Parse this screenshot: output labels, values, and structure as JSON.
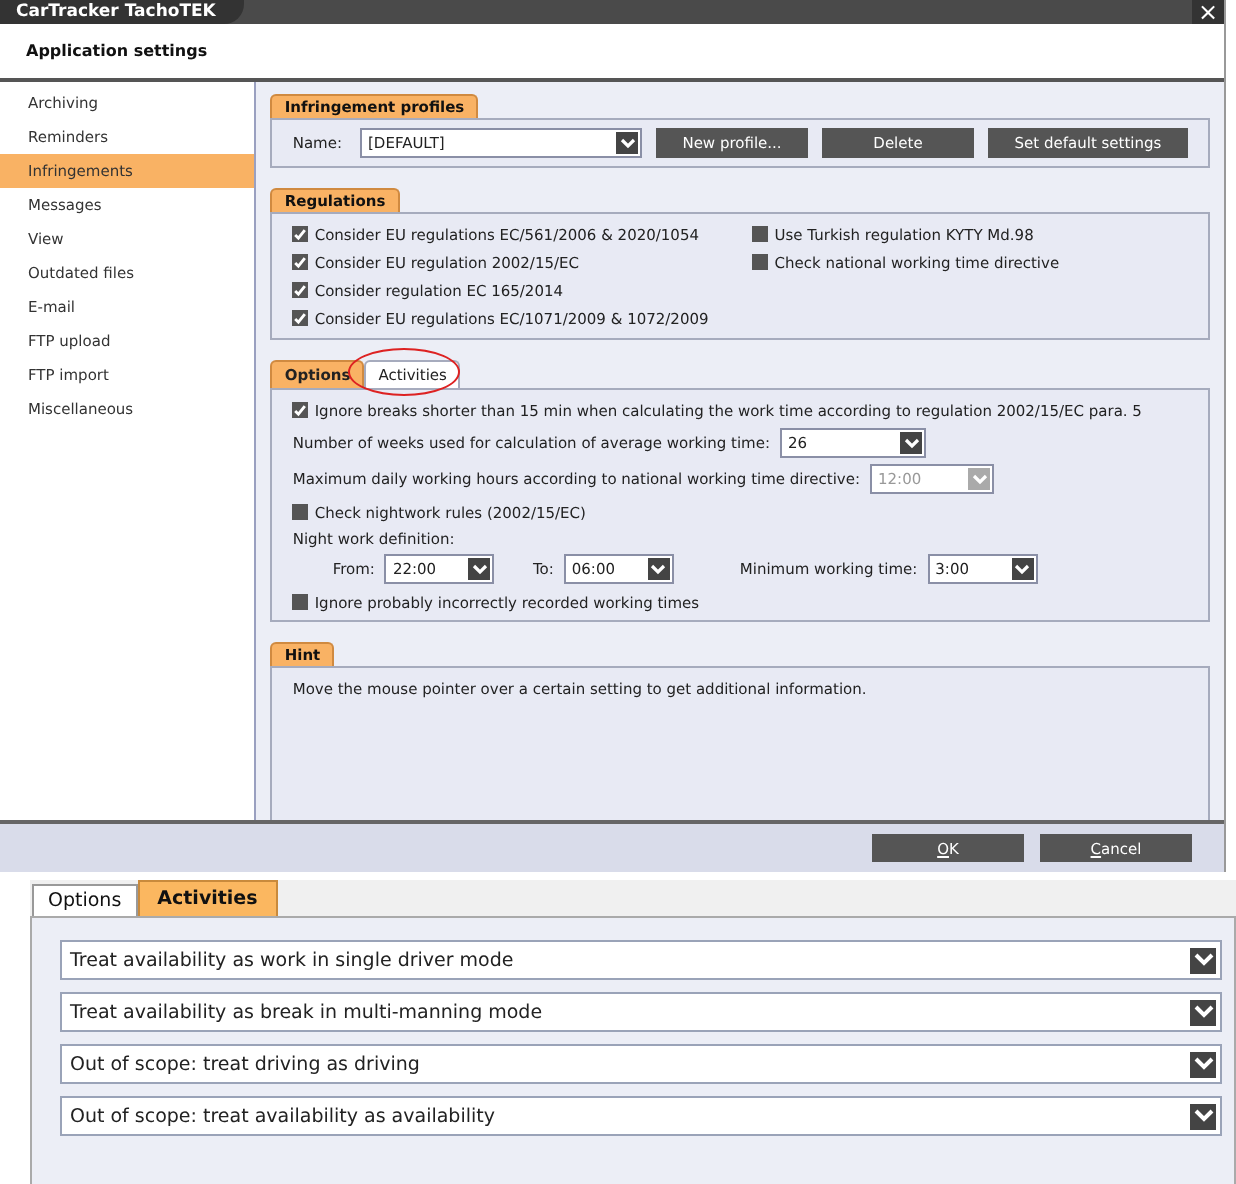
{
  "window": {
    "title": "CarTracker TachoTEK",
    "close": "×"
  },
  "header": {
    "title": "Application settings"
  },
  "sidebar": {
    "items": [
      {
        "label": "Archiving",
        "selected": false
      },
      {
        "label": "Reminders",
        "selected": false
      },
      {
        "label": "Infringements",
        "selected": true
      },
      {
        "label": "Messages",
        "selected": false
      },
      {
        "label": "View",
        "selected": false
      },
      {
        "label": "Outdated files",
        "selected": false
      },
      {
        "label": "E-mail",
        "selected": false
      },
      {
        "label": "FTP upload",
        "selected": false
      },
      {
        "label": "FTP import",
        "selected": false
      },
      {
        "label": "Miscellaneous",
        "selected": false
      }
    ]
  },
  "profiles": {
    "title": "Infringement profiles",
    "name_label": "Name:",
    "name_value": "[DEFAULT]",
    "buttons": [
      "New profile...",
      "Delete",
      "Set default settings"
    ]
  },
  "regulations": {
    "title": "Regulations",
    "left": [
      {
        "label": "Consider EU regulations EC/561/2006 & 2020/1054",
        "checked": true
      },
      {
        "label": "Consider EU regulation 2002/15/EC",
        "checked": true
      },
      {
        "label": "Consider regulation EC 165/2014",
        "checked": true
      },
      {
        "label": "Consider EU regulations EC/1071/2009 & 1072/2009",
        "checked": true
      }
    ],
    "right": [
      {
        "label": "Use Turkish regulation KYTY Md.98",
        "checked": false
      },
      {
        "label": "Check national working time directive",
        "checked": false
      }
    ]
  },
  "options_tabs": [
    {
      "label": "Options",
      "selected": true,
      "circled": false
    },
    {
      "label": "Activities",
      "selected": false,
      "circled": true
    }
  ],
  "options": {
    "ignore_breaks": {
      "label": "Ignore breaks shorter than 15 min when calculating the work time according to regulation 2002/15/EC para. 5",
      "checked": true
    },
    "weeks": {
      "label": "Number of weeks used for calculation of average working time:",
      "value": "26",
      "disabled": false
    },
    "max_daily": {
      "label": "Maximum daily working hours according to national working time directive:",
      "value": "12:00",
      "disabled": true
    },
    "nightwork": {
      "label": "Check nightwork rules (2002/15/EC)",
      "checked": false
    },
    "night_def": "Night work definition:",
    "times": [
      {
        "label": "From:",
        "value": "22:00"
      },
      {
        "label": "To:",
        "value": "06:00"
      },
      {
        "label": "Minimum working time:",
        "value": "3:00"
      }
    ],
    "ignore_incorrect": {
      "label": "Ignore probably incorrectly recorded working times",
      "checked": false
    }
  },
  "hint": {
    "title": "Hint",
    "text": "Move the mouse pointer over a certain setting to get additional information."
  },
  "footer": {
    "buttons": [
      "OK",
      "Cancel"
    ]
  },
  "inset": {
    "tabs": [
      {
        "label": "Options",
        "selected": false
      },
      {
        "label": "Activities",
        "selected": true
      }
    ],
    "selects": [
      "Treat availability as work in single driver mode",
      "Treat availability as break in multi-manning mode",
      "Out of scope: treat driving as driving",
      "Out of scope: treat availability as availability"
    ]
  }
}
